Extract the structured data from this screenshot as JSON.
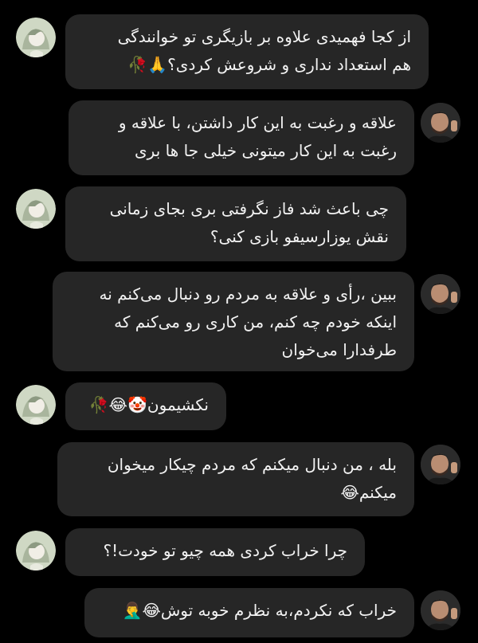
{
  "colors": {
    "background": "#000000",
    "bubble": "#262626",
    "text": "#f2f2f2"
  },
  "messages": [
    {
      "sender": "other",
      "avatar": "anime-girl-avatar",
      "text": "از کجا فهمیدی علاوه بر بازیگری تو خوانندگی\nهم استعداد نداری و شروعش کردی؟🙏🥀"
    },
    {
      "sender": "me",
      "avatar": "man-portrait-avatar",
      "text": "علاقه و رغبت به این کار داشتن، با علاقه و\nرغبت به این کار میتونی خیلی جا ها بری"
    },
    {
      "sender": "other",
      "avatar": "anime-girl-avatar",
      "text": "چی باعث شد فاز نگرفتی بری بجای زمانی\nنقش یوزارسیفو بازی کنی؟"
    },
    {
      "sender": "me",
      "avatar": "man-portrait-avatar",
      "text": "ببین ،رأی و علاقه به مردم رو دنبال می‌کنم نه\nاینکه خودم چه کنم، من کاری رو می‌کنم که\nطرفدارا می‌خوان"
    },
    {
      "sender": "other",
      "avatar": "anime-girl-avatar",
      "text": "نکشیمون🤡😂🥀"
    },
    {
      "sender": "me",
      "avatar": "man-portrait-avatar",
      "text": "بله ، من دنبال میکنم که مردم چیکار میخوان\nمیکنم😂"
    },
    {
      "sender": "other",
      "avatar": "anime-girl-avatar",
      "text": "چرا خراب کردی همه چیو تو خودت!؟"
    },
    {
      "sender": "me",
      "avatar": "man-portrait-avatar",
      "text": "خراب که نکردم،به نظرم خوبه توش😂🤦‍♂️"
    }
  ]
}
